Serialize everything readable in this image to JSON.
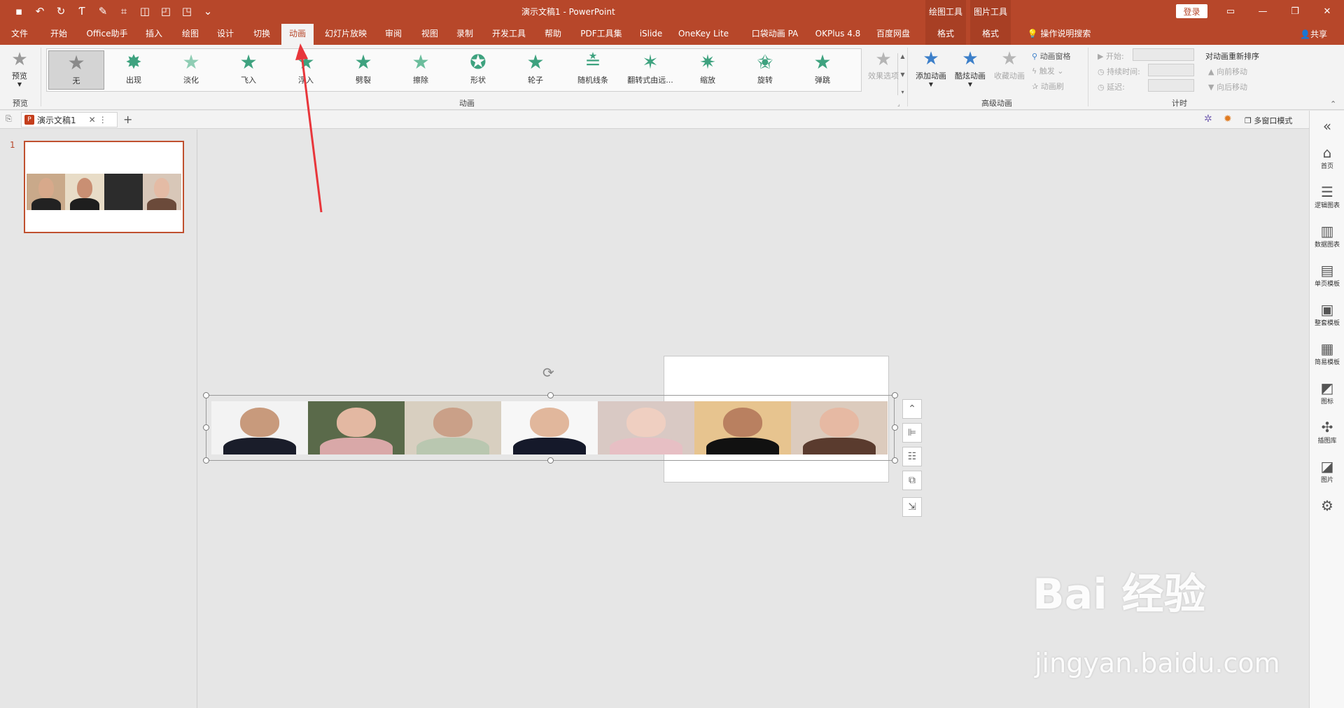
{
  "titlebar": {
    "title": "演示文稿1  -  PowerPoint",
    "ctx_drawing": "绘图工具",
    "ctx_picture": "图片工具",
    "login": "登录"
  },
  "tabs": [
    "文件",
    "开始",
    "Office助手",
    "插入",
    "绘图",
    "设计",
    "切换",
    "动画",
    "幻灯片放映",
    "审阅",
    "视图",
    "录制",
    "开发工具",
    "帮助",
    "PDF工具集",
    "iSlide",
    "OneKey Lite",
    "口袋动画 PA",
    "OKPlus 4.8",
    "百度网盘",
    "格式",
    "格式"
  ],
  "tell_me": "操作说明搜索",
  "share": "共享",
  "ribbon": {
    "preview": "预览",
    "preview_group": "预览",
    "animations": [
      {
        "label": "无",
        "icon": "star-none-icon"
      },
      {
        "label": "出现",
        "icon": "star-appear-icon"
      },
      {
        "label": "淡化",
        "icon": "star-fade-icon"
      },
      {
        "label": "飞入",
        "icon": "star-fly-in-icon"
      },
      {
        "label": "浮入",
        "icon": "star-float-in-icon"
      },
      {
        "label": "劈裂",
        "icon": "star-split-icon"
      },
      {
        "label": "擦除",
        "icon": "star-wipe-icon"
      },
      {
        "label": "形状",
        "icon": "star-shape-icon"
      },
      {
        "label": "轮子",
        "icon": "star-wheel-icon"
      },
      {
        "label": "随机线条",
        "icon": "star-random-bars-icon"
      },
      {
        "label": "翻转式由远...",
        "icon": "star-grow-turn-icon"
      },
      {
        "label": "缩放",
        "icon": "star-zoom-icon"
      },
      {
        "label": "旋转",
        "icon": "star-swivel-icon"
      },
      {
        "label": "弹跳",
        "icon": "star-bounce-icon"
      }
    ],
    "effect_options": "效果选项",
    "animation_group": "动画",
    "add_animation": "添加动画",
    "cool_animation": "酷炫动画",
    "fav_animation": "收藏动画",
    "animation_pane": "动画窗格",
    "trigger": "触发",
    "animation_painter": "动画刷",
    "advanced_group": "高级动画",
    "start": "开始:",
    "duration": "持续时间:",
    "delay": "延迟:",
    "reorder": "对动画重新排序",
    "move_earlier": "向前移动",
    "move_later": "向后移动",
    "timing_group": "计时"
  },
  "docbar": {
    "doc_tab": "演示文稿1",
    "multiwindow": "多窗口模式"
  },
  "slide_number": "1",
  "right_panel": [
    "首页",
    "逻辑图表",
    "数据图表",
    "单页模板",
    "整套模板",
    "简易模板",
    "图标",
    "插图库",
    "图片"
  ],
  "watermark": {
    "main": "Bai 经验",
    "url": "jingyan.baidu.com"
  },
  "colors": {
    "accent": "#b7472a",
    "star_green": "#3ea27f",
    "arrow": "#e8363b"
  }
}
